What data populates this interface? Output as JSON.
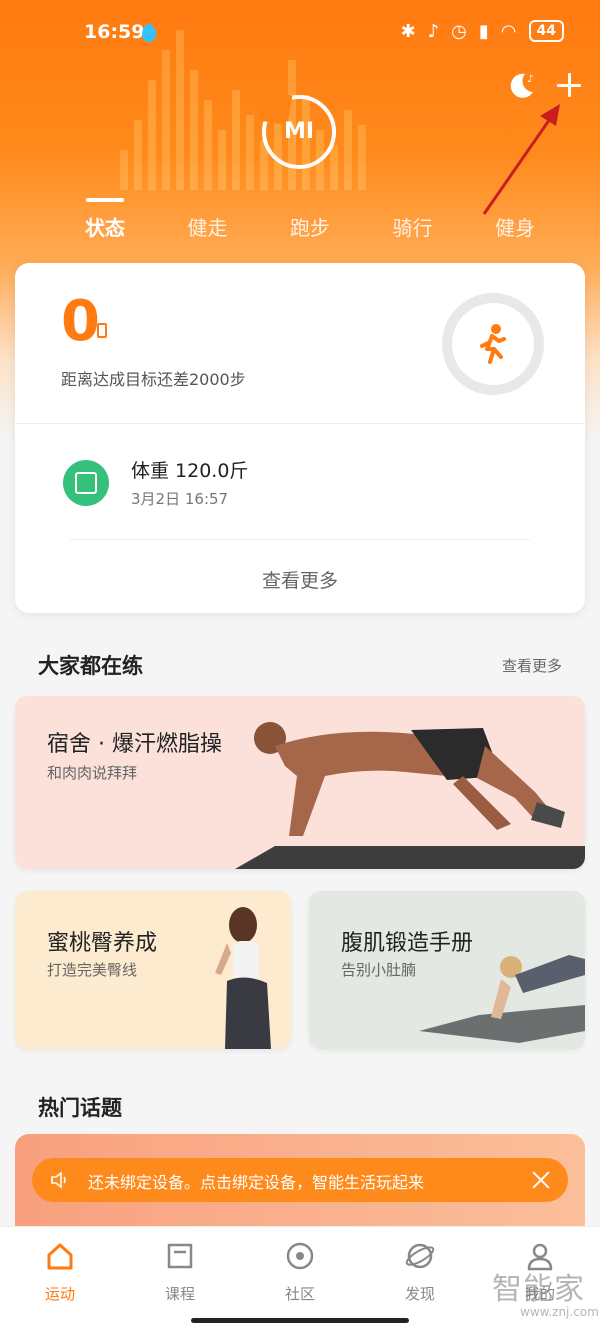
{
  "status_bar": {
    "time": "16:59",
    "battery": "44"
  },
  "header": {
    "logo": "MI",
    "tabs": [
      {
        "label": "状态",
        "active": true
      },
      {
        "label": "健走",
        "active": false
      },
      {
        "label": "跑步",
        "active": false
      },
      {
        "label": "骑行",
        "active": false
      },
      {
        "label": "健身",
        "active": false
      }
    ]
  },
  "summary": {
    "steps": "0",
    "goal_text": "距离达成目标还差2000步",
    "weight_label": "体重 120.0斤",
    "weight_date": "3月2日 16:57",
    "view_more": "查看更多"
  },
  "training": {
    "title": "大家都在练",
    "more": "查看更多",
    "featured": {
      "title": "宿舍 · 爆汗燃脂操",
      "subtitle": "和肉肉说拜拜"
    },
    "cards": [
      {
        "title": "蜜桃臀养成",
        "subtitle": "打造完美臀线"
      },
      {
        "title": "腹肌锻造手册",
        "subtitle": "告别小肚腩"
      }
    ]
  },
  "topics": {
    "title": "热门话题"
  },
  "toast": {
    "text": "还未绑定设备。点击绑定设备，智能生活玩起来"
  },
  "bottom_nav": [
    {
      "label": "运动",
      "icon": "home-icon",
      "active": true
    },
    {
      "label": "课程",
      "icon": "course-icon",
      "active": false
    },
    {
      "label": "社区",
      "icon": "community-icon",
      "active": false
    },
    {
      "label": "发现",
      "icon": "discover-icon",
      "active": false
    },
    {
      "label": "我的",
      "icon": "profile-icon",
      "active": false
    }
  ],
  "watermark": {
    "brand": "智能家",
    "url": "www.znj.com"
  },
  "colors": {
    "accent": "#ff7a10",
    "weight_green": "#35c07b",
    "annotation_red": "#c81e1e"
  }
}
